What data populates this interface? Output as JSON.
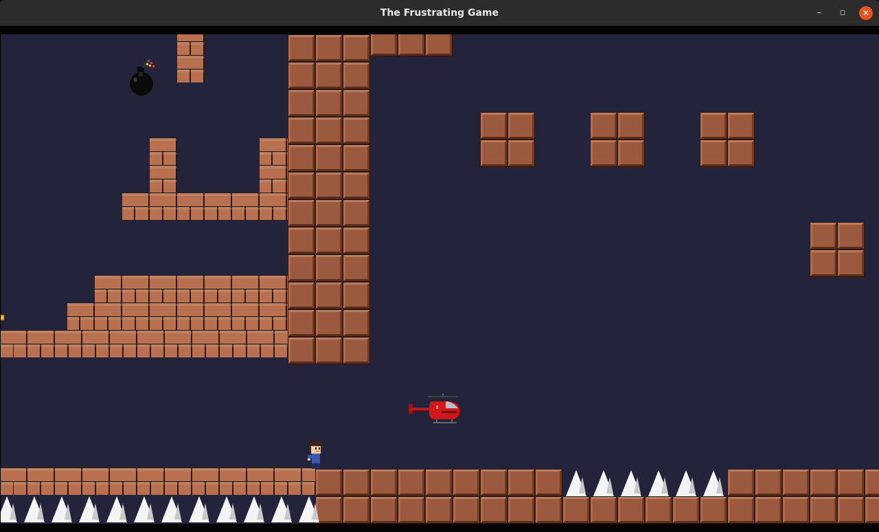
{
  "window": {
    "title": "The Frustrating Game",
    "minimize_glyph": "–",
    "maximize_glyph": "◻",
    "close_glyph": "✕"
  },
  "colors": {
    "background": "#23233b",
    "block": "#9b5a3e",
    "brick": "#b8704e",
    "spike": "#f4f4f4",
    "helicopter": "#d01818",
    "close_button": "#e95420"
  },
  "sprites": {
    "player": "player-character",
    "enemy": "helicopter",
    "hazard": "bomb",
    "projectile": "fireball",
    "trap": "spikes"
  }
}
